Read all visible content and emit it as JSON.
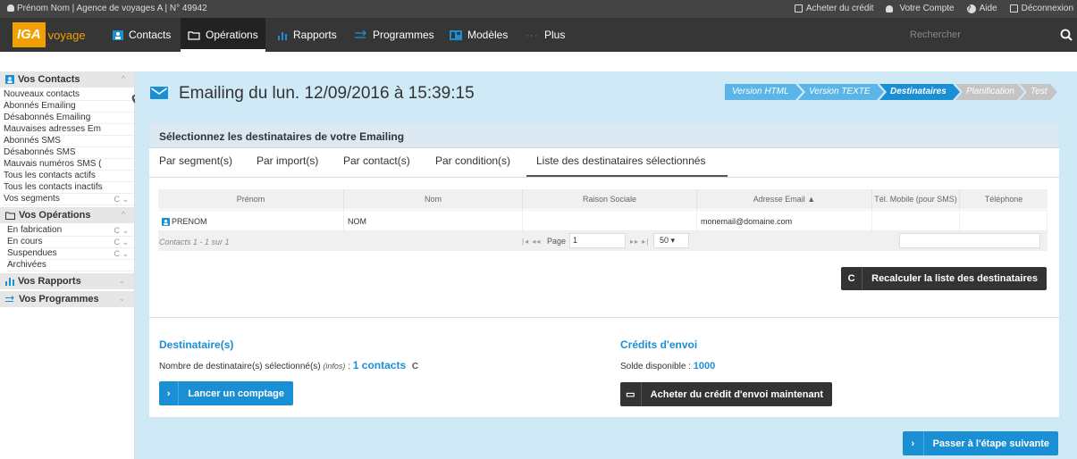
{
  "topbar": {
    "user_info": "Prénom Nom | Agence de voyages A | N° 49942",
    "buy_credit": "Acheter du crédit",
    "account": "Votre Compte",
    "help": "Aide",
    "logout": "Déconnexion"
  },
  "logo": {
    "iga": "IGA",
    "voyage": "voyage"
  },
  "nav": {
    "contacts": "Contacts",
    "operations": "Opérations",
    "reports": "Rapports",
    "programs": "Programmes",
    "models": "Modèles",
    "more": "Plus",
    "search_placeholder": "Rechercher"
  },
  "sidebar": {
    "contacts_head": "Vos Contacts",
    "contacts_items": [
      "Nouveaux contacts",
      "Abonnés Emailing",
      "Désabonnés Emailing",
      "Mauvaises adresses Em",
      "Abonnés SMS",
      "Désabonnés SMS",
      "Mauvais numéros SMS (",
      "Tous les contacts actifs",
      "Tous les contacts inactifs",
      "Vos segments"
    ],
    "operations_head": "Vos Opérations",
    "operations_items": [
      "En fabrication",
      "En cours",
      "Suspendues",
      "Archivées"
    ],
    "reports_head": "Vos Rapports",
    "programs_head": "Vos Programmes"
  },
  "page": {
    "title": "Emailing du lun. 12/09/2016 à 15:39:15",
    "steps": [
      "Version HTML",
      "Version TEXTE",
      "Destinataires",
      "Planification",
      "Test"
    ],
    "panel_title": "Sélectionnez les destinataires de votre Emailing",
    "tabs": [
      "Par segment(s)",
      "Par import(s)",
      "Par contact(s)",
      "Par condition(s)",
      "Liste des destinataires sélectionnés"
    ]
  },
  "table": {
    "headers": [
      "Prénom",
      "Nom",
      "Raison Sociale",
      "Adresse Email ▲",
      "Tél. Mobile (pour SMS)",
      "Téléphone"
    ],
    "rows": [
      {
        "prenom": "PRENOM",
        "nom": "NOM",
        "raison": "",
        "email": "monemail@domaine.com",
        "mobile": "",
        "tel": ""
      }
    ],
    "pager_info": "Contacts 1 - 1 sur 1",
    "page_label": "Page",
    "page_value": "1",
    "page_size": "50"
  },
  "buttons": {
    "recalc": "Recalculer la liste des destinataires",
    "count": "Lancer un comptage",
    "buy_credit_now": "Acheter du crédit d'envoi maintenant",
    "next_step": "Passer à l'étape suivante"
  },
  "recipients": {
    "title": "Destinataire(s)",
    "label": "Nombre de destinataire(s) sélectionné(s)",
    "infos": "(infos)",
    "colon": " :",
    "count": "1 contacts"
  },
  "credits": {
    "title": "Crédits d'envoi",
    "label": "Solde disponible :",
    "value": "1000"
  },
  "colors": {
    "accent": "#1b8fd3",
    "logo": "#f0a000",
    "step_done": "#5bb5e6",
    "step_active": "#1b8fd3",
    "step_todo": "#c4c4c4"
  }
}
